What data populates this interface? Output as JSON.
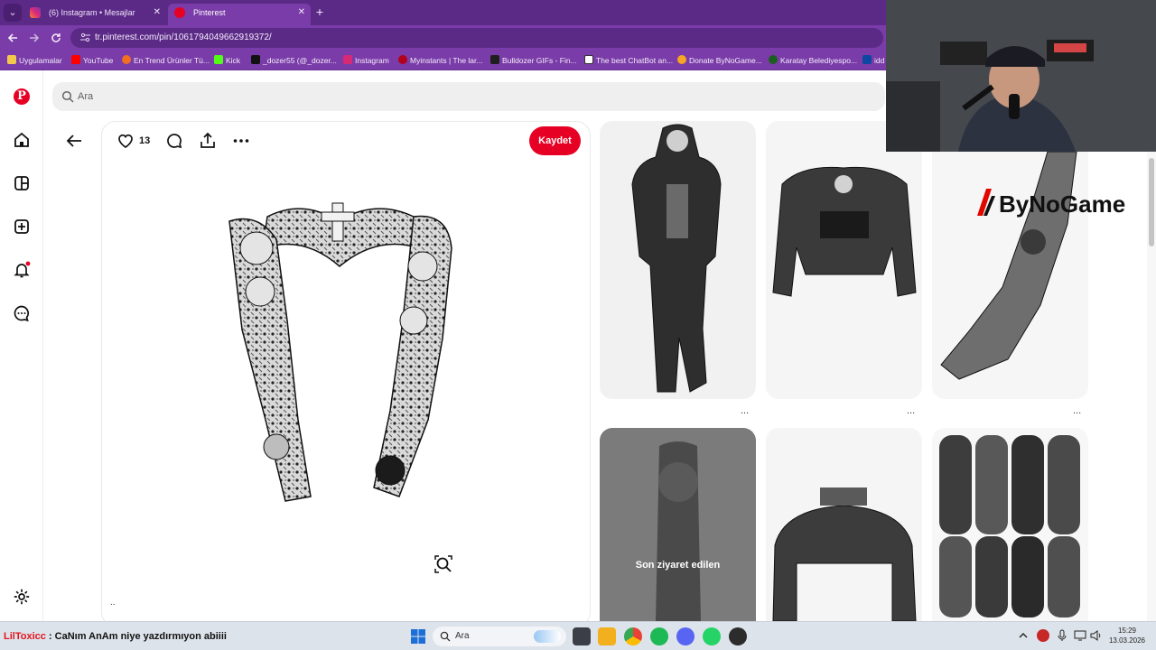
{
  "browser": {
    "tabs": [
      {
        "title": "(6) Instagram • Mesajlar",
        "close": "✕"
      },
      {
        "title": "Pinterest",
        "close": "✕"
      }
    ],
    "new_tab": "+",
    "menu": "⌄",
    "url": "tr.pinterest.com/pin/1061794049662919372/",
    "bookmarks": [
      {
        "label": "Uygulamalar",
        "color": "#f2c94c"
      },
      {
        "label": "YouTube",
        "color": "#ff0000"
      },
      {
        "label": "En Trend Ürünler Tü...",
        "color": "#f26f21"
      },
      {
        "label": "Kick",
        "color": "#53fc18"
      },
      {
        "label": "_dozer55 (@_dozer...",
        "color": "#111111"
      },
      {
        "label": "Instagram",
        "color": "#d62976"
      },
      {
        "label": "Myinstants | The lar...",
        "color": "#b3001b"
      },
      {
        "label": "Bulldozer GIFs - Fin...",
        "color": "#1f1f1f"
      },
      {
        "label": "The best ChatBot an...",
        "color": "#ffffff"
      },
      {
        "label": "Donate ByNoGame...",
        "color": "#f5a623"
      },
      {
        "label": "Karatay Belediyespo...",
        "color": "#1b5e20"
      },
      {
        "label": "idd",
        "color": "#0d47a1"
      }
    ]
  },
  "pinterest": {
    "search_placeholder": "Ara",
    "like_count": "13",
    "save_label": "Kaydet",
    "more_dots": "...",
    "small_dots": "..",
    "recently_visited": "Son ziyaret edilen",
    "brand_color": "#e60023"
  },
  "overlay": {
    "sponsor_text": "ByNoGame",
    "chat_user": "LilToxicc",
    "chat_message": " : CaNım AnAm niye yazdırmıyon abiiii"
  },
  "taskbar": {
    "search_placeholder": "Ara",
    "time": "15:29",
    "date": "13.03.2026"
  }
}
